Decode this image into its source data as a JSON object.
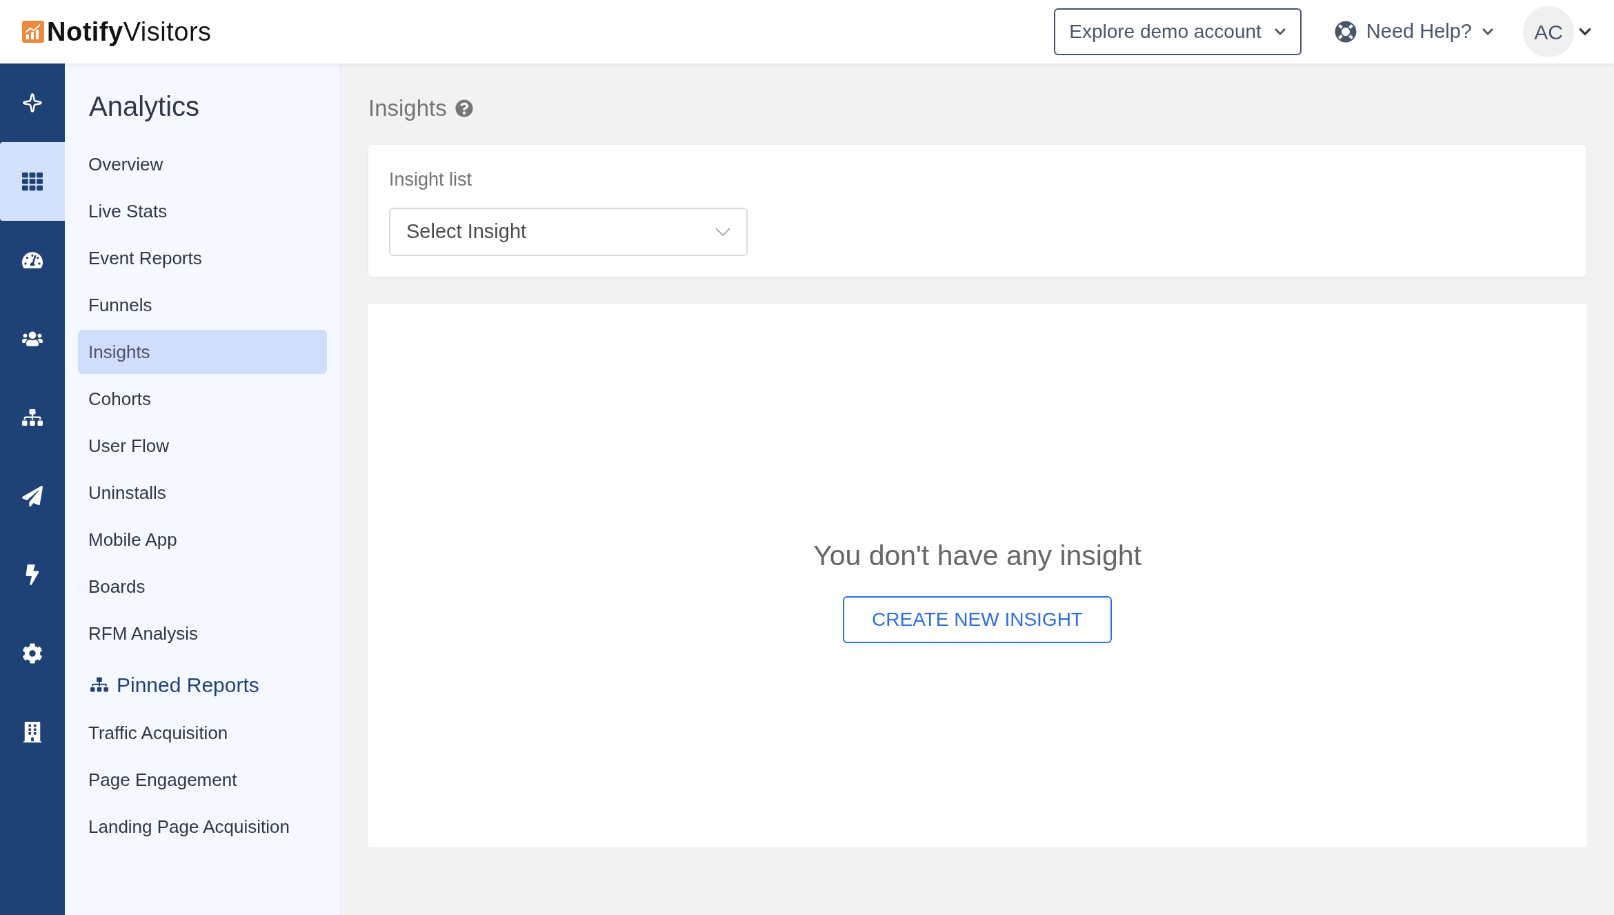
{
  "header": {
    "logo_bold": "Notify",
    "logo_light": "Visitors",
    "demo_button": "Explore demo account",
    "help": "Need Help?",
    "avatar": "AC"
  },
  "rail": [
    {
      "kind": "sparkle",
      "selected": false
    },
    {
      "kind": "grid",
      "selected": true
    },
    {
      "kind": "gauge",
      "selected": false
    },
    {
      "kind": "users",
      "selected": false
    },
    {
      "kind": "sitemap",
      "selected": false
    },
    {
      "kind": "send",
      "selected": false
    },
    {
      "kind": "bolt",
      "selected": false
    },
    {
      "kind": "settings",
      "selected": false
    },
    {
      "kind": "building",
      "selected": false
    }
  ],
  "sidebar": {
    "title": "Analytics",
    "items": [
      {
        "label": "Overview",
        "selected": false
      },
      {
        "label": "Live Stats",
        "selected": false
      },
      {
        "label": "Event Reports",
        "selected": false
      },
      {
        "label": "Funnels",
        "selected": false
      },
      {
        "label": "Insights",
        "selected": true
      },
      {
        "label": "Cohorts",
        "selected": false
      },
      {
        "label": "User Flow",
        "selected": false
      },
      {
        "label": "Uninstalls",
        "selected": false
      },
      {
        "label": "Mobile App",
        "selected": false
      },
      {
        "label": "Boards",
        "selected": false
      },
      {
        "label": "RFM Analysis",
        "selected": false
      }
    ],
    "pinned_title": "Pinned Reports",
    "pinned_items": [
      "Traffic Acquisition",
      "Page Engagement",
      "Landing Page Acquisition"
    ]
  },
  "page": {
    "title": "Insights",
    "list_label": "Insight list",
    "select_placeholder": "Select Insight",
    "empty_message": "You don't have any insight",
    "create_button": "CREATE NEW INSIGHT"
  }
}
